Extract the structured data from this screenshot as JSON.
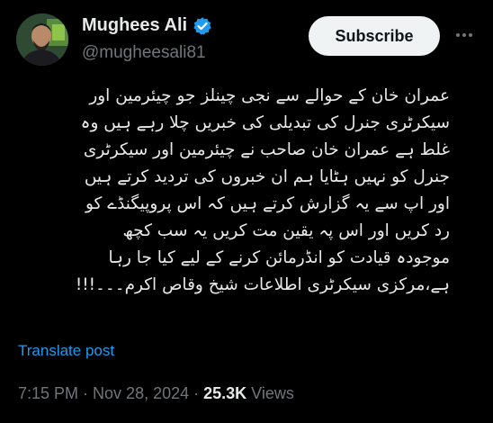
{
  "author": {
    "name": "Mughees Ali",
    "handle": "@mugheesali81",
    "verified_color": "#1d9bf0"
  },
  "actions": {
    "subscribe_label": "Subscribe",
    "more_icon": "more-horizontal-icon"
  },
  "tweet": {
    "lines": [
      "عمران خان کے حوالے سے نجی چینلز جو چیئرمین اور",
      "سیکرٹری جنرل کی تبدیلی کی خبریں چلا رہے ہیں وہ",
      "غلط ہے عمران خان صاحب نے چیئرمین اور سیکرٹری",
      "جنرل کو نہیں ہٹایا ہم ان خبروں کی تردید کرتے ہیں",
      "اور اپ سے یہ گزارش کرتے ہیں کہ اس پروپیگنڈے کو",
      "رد کریں اور اس پہ یقین مت کریں یہ سب کچھ",
      "موجودہ قیادت کو انڈرمائن کرنے کے لیے کیا جا رہا",
      "ہے،مرکزی سیکرٹری اطلاعات شیخ وقاص اکرم۔۔۔!!!"
    ],
    "translate_label": "Translate post"
  },
  "meta": {
    "time": "7:15 PM",
    "separator": "·",
    "date": "Nov 28, 2024",
    "views_count": "25.3K",
    "views_label": "Views"
  },
  "colors": {
    "background": "#000000",
    "text": "#e7e9ea",
    "muted": "#71767b",
    "accent": "#1d9bf0",
    "button_bg": "#eff3f4"
  }
}
